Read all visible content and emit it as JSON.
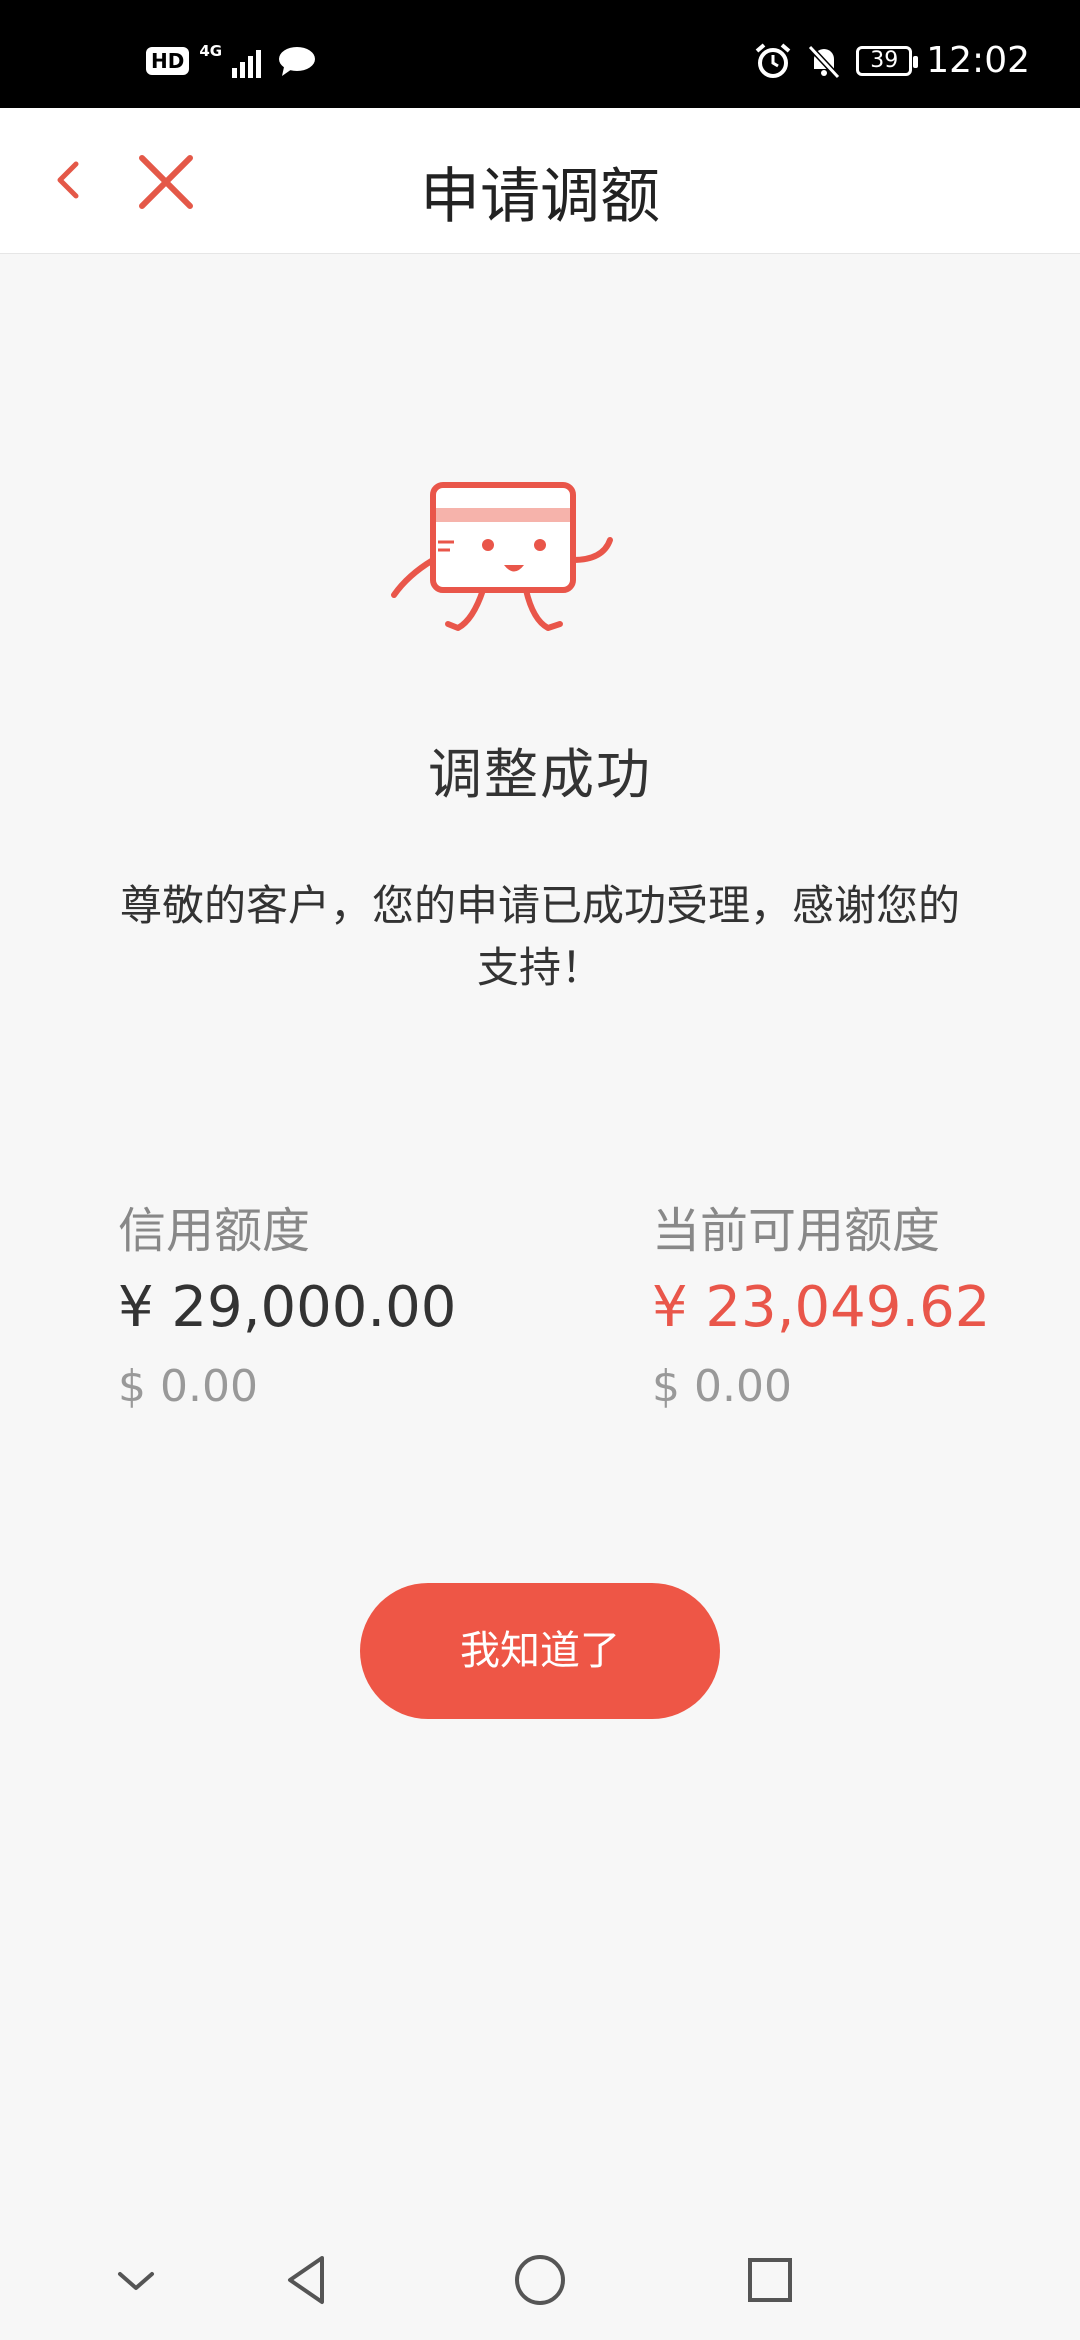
{
  "status_bar": {
    "left_badge": "HD",
    "network_label": "4G",
    "battery": "39",
    "time": "12:02"
  },
  "header": {
    "title": "申请调额",
    "back_icon": "chevron-left-icon",
    "close_icon": "close-icon"
  },
  "result": {
    "title": "调整成功",
    "message": "尊敬的客户，您的申请已成功受理，感谢您的支持！"
  },
  "limits": {
    "credit": {
      "label": "信用额度",
      "cny": "¥ 29,000.00",
      "usd": "$ 0.00"
    },
    "available": {
      "label": "当前可用额度",
      "cny": "¥ 23,049.62",
      "usd": "$ 0.00"
    }
  },
  "actions": {
    "ok_label": "我知道了"
  },
  "colors": {
    "accent": "#ee5646",
    "amount_accent": "#e9564a"
  }
}
